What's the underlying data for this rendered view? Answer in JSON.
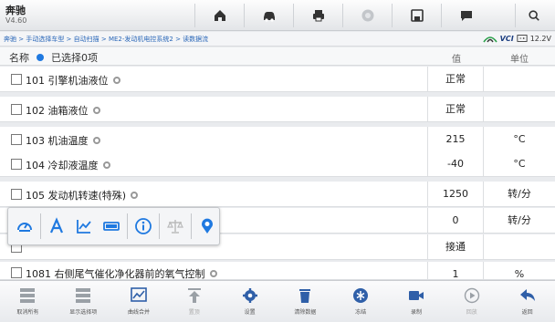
{
  "app": {
    "title": "奔驰",
    "version": "V4.60"
  },
  "toolbar": {
    "buttons": [
      {
        "icon": "home-icon"
      },
      {
        "icon": "car-icon"
      },
      {
        "icon": "printer-icon"
      },
      {
        "icon": "help-icon"
      },
      {
        "icon": "save-icon"
      },
      {
        "icon": "message-icon"
      }
    ],
    "search_icon": "search-icon"
  },
  "breadcrumb": "奔驰 > 手动选择车型 > 自动扫描 > ME2-发动机电控系统2 > 读数据流",
  "status": {
    "vci_label": "VCI",
    "battery_voltage": "12.2V"
  },
  "table": {
    "header": {
      "name": "名称",
      "selected": "已选择0项",
      "value": "值",
      "unit": "单位"
    },
    "rows": [
      {
        "name": "101 引擎机油液位",
        "value": "正常",
        "unit": ""
      },
      {
        "name": "102 油箱液位",
        "value": "正常",
        "unit": ""
      },
      {
        "name": "103 机油温度",
        "value": "215",
        "unit": "°C"
      },
      {
        "name": "104 冷却液温度",
        "value": "-40",
        "unit": "°C"
      },
      {
        "name": "105 发动机转速(特殊)",
        "value": "1250",
        "unit": "转/分"
      },
      {
        "name": "",
        "value": "0",
        "unit": "转/分"
      },
      {
        "name": "",
        "value": "接通",
        "unit": ""
      },
      {
        "name": "1081 右侧尾气催化净化器前的氧气控制",
        "value": "1",
        "unit": "%"
      }
    ]
  },
  "popup": {
    "icons": [
      "gauge-icon",
      "text-icon",
      "line-graph-icon",
      "bar-icon",
      "info-icon",
      "scale-icon",
      "location-icon"
    ]
  },
  "bottombar": {
    "buttons": [
      {
        "label": "取消所有",
        "icon": "grid-icon"
      },
      {
        "label": "显示选择项",
        "icon": "grid-icon"
      },
      {
        "label": "曲线合并",
        "icon": "merge-chart-icon"
      },
      {
        "label": "置顶",
        "icon": "pin-top-icon"
      },
      {
        "label": "设置",
        "icon": "settings-icon"
      },
      {
        "label": "清除数据",
        "icon": "trash-icon"
      },
      {
        "label": "冻结",
        "icon": "freeze-icon"
      },
      {
        "label": "录制",
        "icon": "record-icon"
      },
      {
        "label": "回放",
        "icon": "play-icon"
      },
      {
        "label": "返回",
        "icon": "back-icon"
      }
    ]
  },
  "colors": {
    "accent": "#1f79e0",
    "link": "#2a67b8",
    "record": "#2f5fa8"
  }
}
